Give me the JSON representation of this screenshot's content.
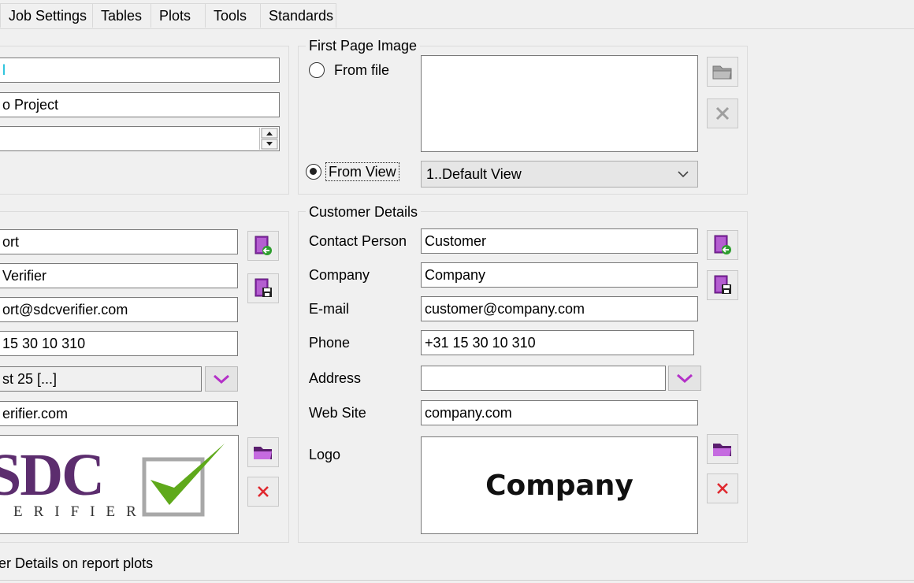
{
  "tabs": [
    "Job Settings",
    "Tables",
    "Plots",
    "Tools",
    "Standards"
  ],
  "project": {
    "field1": "l",
    "field2": "o Project",
    "field3": ""
  },
  "first_page_image": {
    "legend": "First Page Image",
    "from_file_label": "From file",
    "from_view_label": "From View",
    "view_selected": "1..Default View"
  },
  "contractor": {
    "name": "ort",
    "company": "Verifier",
    "email": "ort@sdcverifier.com",
    "phone": "15 30 10 310",
    "address": "st 25 [...]",
    "website": "erifier.com",
    "logo_main": "SDC",
    "logo_sub": "ERIFIER"
  },
  "customer": {
    "legend": "Customer Details",
    "labels": {
      "contact_person": "Contact Person",
      "company": "Company",
      "email": "E-mail",
      "phone": "Phone",
      "address": "Address",
      "website": "Web Site",
      "logo": "Logo"
    },
    "values": {
      "contact_person": "Customer",
      "company": "Company",
      "email": "customer@company.com",
      "phone": "+31 15 30 10 310",
      "address": "",
      "website": "company.com"
    },
    "logo_text": "Company"
  },
  "footer_checkbox_label": "er Details on report plots"
}
